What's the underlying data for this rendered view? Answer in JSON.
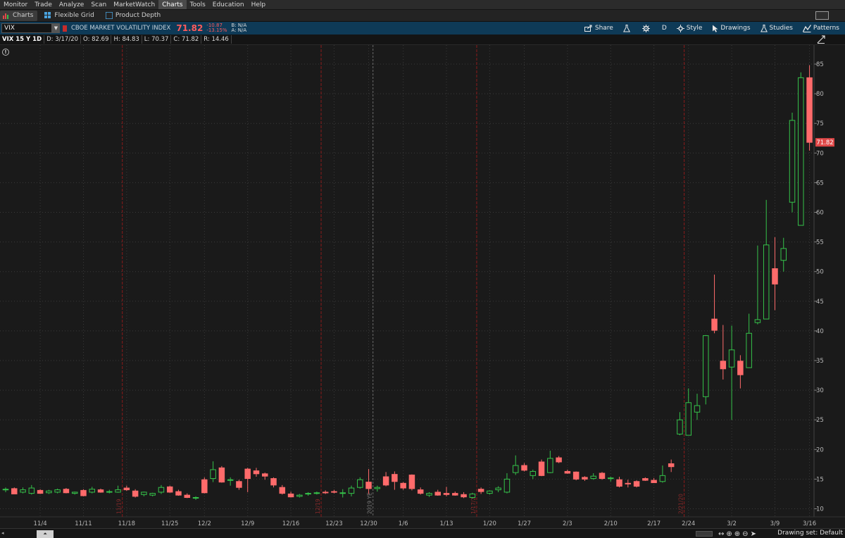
{
  "menu": {
    "items": [
      "Monitor",
      "Trade",
      "Analyze",
      "Scan",
      "MarketWatch",
      "Charts",
      "Tools",
      "Education",
      "Help"
    ],
    "active": "Charts"
  },
  "subtabs": [
    {
      "label": "Charts",
      "icon": "chart-icon",
      "active": true
    },
    {
      "label": "Flexible Grid",
      "icon": "grid-icon",
      "active": false
    },
    {
      "label": "Product Depth",
      "icon": "depth-icon",
      "active": false
    }
  ],
  "symbol": {
    "value": "VIX",
    "description": "CBOE MARKET VOLATILITY INDEX",
    "price": "71.82",
    "change": "-10.87",
    "change_pct": "-13.15%",
    "bid": "B: N/A",
    "ask": "A: N/A"
  },
  "toolbar": {
    "share": "Share",
    "aggregation": "D",
    "style": "Style",
    "drawings": "Drawings",
    "studies": "Studies",
    "patterns": "Patterns"
  },
  "info": {
    "title": "VIX 15 Y 1D",
    "date": "D: 3/17/20",
    "open": "O: 82.69",
    "high": "H: 84.83",
    "low": "L: 70.37",
    "close": "C: 71.82",
    "range": "R: 14.46"
  },
  "bottom": {
    "drawing_set": "Drawing set: Default"
  },
  "colors": {
    "up": "#35c24a",
    "down": "#ff6b6b",
    "background": "#1a1a1a",
    "grid": "#3a3a3a",
    "separator": "#8b1a1a",
    "year_separator": "#6a6a6a",
    "symbol_bar": "#0e3a57"
  },
  "chart_data": {
    "type": "candlestick",
    "ylim": [
      9,
      86
    ],
    "y_ticks": [
      10,
      15,
      20,
      25,
      30,
      35,
      40,
      45,
      50,
      55,
      60,
      65,
      70,
      75,
      80,
      85
    ],
    "x_tick_labels": [
      "11/4",
      "11/11",
      "11/18",
      "11/25",
      "12/2",
      "12/9",
      "12/16",
      "12/23",
      "12/30",
      "1/6",
      "1/13",
      "1/20",
      "1/27",
      "2/3",
      "2/10",
      "2/17",
      "2/24",
      "3/2",
      "3/9",
      "3/16"
    ],
    "x_tick_index": [
      4,
      9,
      14,
      19,
      23,
      28,
      33,
      38,
      42,
      46,
      51,
      56,
      60,
      65,
      70,
      75,
      79,
      84,
      89,
      93
    ],
    "month_separators": [
      {
        "index": 14,
        "label": "11/19",
        "kind": "month"
      },
      {
        "index": 37,
        "label": "12/19",
        "kind": "month"
      },
      {
        "index": 43,
        "label": "2019 YE",
        "kind": "year"
      },
      {
        "index": 55,
        "label": "1/17/20",
        "kind": "month"
      },
      {
        "index": 79,
        "label": "2/21/20",
        "kind": "month"
      }
    ],
    "current_price_label": "71.82",
    "candles": [
      {
        "o": 13.2,
        "h": 13.6,
        "l": 12.8,
        "c": 13.3
      },
      {
        "o": 13.4,
        "h": 13.6,
        "l": 12.5,
        "c": 12.5
      },
      {
        "o": 12.8,
        "h": 13.6,
        "l": 12.6,
        "c": 13.2
      },
      {
        "o": 12.6,
        "h": 14.0,
        "l": 12.4,
        "c": 13.5
      },
      {
        "o": 13.1,
        "h": 13.3,
        "l": 12.5,
        "c": 12.6
      },
      {
        "o": 12.7,
        "h": 13.2,
        "l": 12.5,
        "c": 13.0
      },
      {
        "o": 12.8,
        "h": 13.4,
        "l": 12.6,
        "c": 13.2
      },
      {
        "o": 13.3,
        "h": 13.5,
        "l": 12.6,
        "c": 12.7
      },
      {
        "o": 12.6,
        "h": 12.9,
        "l": 12.4,
        "c": 12.8
      },
      {
        "o": 13.1,
        "h": 13.3,
        "l": 12.1,
        "c": 12.2
      },
      {
        "o": 12.8,
        "h": 13.7,
        "l": 12.6,
        "c": 13.3
      },
      {
        "o": 13.2,
        "h": 13.4,
        "l": 12.7,
        "c": 12.8
      },
      {
        "o": 12.9,
        "h": 13.2,
        "l": 12.6,
        "c": 12.9
      },
      {
        "o": 12.8,
        "h": 13.9,
        "l": 12.7,
        "c": 13.2
      },
      {
        "o": 13.5,
        "h": 13.9,
        "l": 13.0,
        "c": 13.2
      },
      {
        "o": 13.0,
        "h": 13.3,
        "l": 11.9,
        "c": 12.1
      },
      {
        "o": 12.4,
        "h": 12.9,
        "l": 12.1,
        "c": 12.8
      },
      {
        "o": 12.3,
        "h": 12.7,
        "l": 12.1,
        "c": 12.6
      },
      {
        "o": 12.8,
        "h": 14.0,
        "l": 12.5,
        "c": 13.6
      },
      {
        "o": 13.7,
        "h": 13.9,
        "l": 12.7,
        "c": 12.8
      },
      {
        "o": 12.9,
        "h": 13.2,
        "l": 12.2,
        "c": 12.3
      },
      {
        "o": 12.3,
        "h": 12.6,
        "l": 11.8,
        "c": 11.9
      },
      {
        "o": 11.8,
        "h": 12.1,
        "l": 11.5,
        "c": 11.9
      },
      {
        "o": 14.9,
        "h": 15.3,
        "l": 12.6,
        "c": 12.7
      },
      {
        "o": 15.1,
        "h": 18.0,
        "l": 14.5,
        "c": 16.6
      },
      {
        "o": 16.9,
        "h": 17.2,
        "l": 14.4,
        "c": 14.5
      },
      {
        "o": 14.9,
        "h": 15.3,
        "l": 13.9,
        "c": 14.9
      },
      {
        "o": 14.6,
        "h": 14.9,
        "l": 13.2,
        "c": 13.6
      },
      {
        "o": 16.7,
        "h": 16.9,
        "l": 12.8,
        "c": 15.1
      },
      {
        "o": 16.4,
        "h": 16.9,
        "l": 15.4,
        "c": 15.9
      },
      {
        "o": 15.9,
        "h": 16.1,
        "l": 14.9,
        "c": 15.5
      },
      {
        "o": 15.1,
        "h": 15.3,
        "l": 13.6,
        "c": 14.0
      },
      {
        "o": 13.6,
        "h": 14.0,
        "l": 12.4,
        "c": 12.6
      },
      {
        "o": 12.5,
        "h": 12.9,
        "l": 11.9,
        "c": 12.0
      },
      {
        "o": 12.1,
        "h": 12.5,
        "l": 11.9,
        "c": 12.3
      },
      {
        "o": 12.5,
        "h": 12.8,
        "l": 12.2,
        "c": 12.6
      },
      {
        "o": 12.6,
        "h": 12.9,
        "l": 12.4,
        "c": 12.7
      },
      {
        "o": 12.8,
        "h": 13.1,
        "l": 12.5,
        "c": 12.7
      },
      {
        "o": 12.9,
        "h": 13.2,
        "l": 12.6,
        "c": 12.8
      },
      {
        "o": 12.6,
        "h": 13.3,
        "l": 11.9,
        "c": 12.7
      },
      {
        "o": 12.6,
        "h": 13.9,
        "l": 12.1,
        "c": 13.5
      },
      {
        "o": 13.6,
        "h": 15.3,
        "l": 13.4,
        "c": 14.9
      },
      {
        "o": 14.5,
        "h": 16.7,
        "l": 12.5,
        "c": 13.4
      },
      {
        "o": 13.4,
        "h": 13.9,
        "l": 12.9,
        "c": 13.6
      },
      {
        "o": 15.4,
        "h": 16.2,
        "l": 13.8,
        "c": 14.0
      },
      {
        "o": 15.8,
        "h": 16.3,
        "l": 13.2,
        "c": 14.6
      },
      {
        "o": 14.3,
        "h": 14.5,
        "l": 13.2,
        "c": 13.5
      },
      {
        "o": 15.7,
        "h": 15.8,
        "l": 13.1,
        "c": 13.4
      },
      {
        "o": 13.2,
        "h": 13.6,
        "l": 12.4,
        "c": 12.6
      },
      {
        "o": 12.3,
        "h": 12.8,
        "l": 12.0,
        "c": 12.6
      },
      {
        "o": 12.8,
        "h": 13.2,
        "l": 12.2,
        "c": 12.3
      },
      {
        "o": 12.6,
        "h": 13.7,
        "l": 12.1,
        "c": 12.4
      },
      {
        "o": 12.6,
        "h": 12.9,
        "l": 12.2,
        "c": 12.3
      },
      {
        "o": 12.4,
        "h": 12.8,
        "l": 11.8,
        "c": 12.0
      },
      {
        "o": 11.9,
        "h": 12.7,
        "l": 11.7,
        "c": 12.5
      },
      {
        "o": 13.3,
        "h": 13.6,
        "l": 12.5,
        "c": 12.9
      },
      {
        "o": 12.6,
        "h": 13.1,
        "l": 12.4,
        "c": 13.0
      },
      {
        "o": 13.2,
        "h": 13.8,
        "l": 12.8,
        "c": 13.5
      },
      {
        "o": 12.8,
        "h": 16.0,
        "l": 12.6,
        "c": 15.0
      },
      {
        "o": 16.1,
        "h": 19.0,
        "l": 15.7,
        "c": 17.3
      },
      {
        "o": 17.3,
        "h": 17.7,
        "l": 16.3,
        "c": 16.5
      },
      {
        "o": 15.6,
        "h": 16.6,
        "l": 15.0,
        "c": 16.3
      },
      {
        "o": 17.9,
        "h": 18.3,
        "l": 15.5,
        "c": 15.6
      },
      {
        "o": 16.1,
        "h": 19.8,
        "l": 16.0,
        "c": 18.5
      },
      {
        "o": 18.6,
        "h": 18.9,
        "l": 17.7,
        "c": 17.9
      },
      {
        "o": 16.3,
        "h": 16.6,
        "l": 15.9,
        "c": 16.0
      },
      {
        "o": 16.2,
        "h": 16.3,
        "l": 14.8,
        "c": 15.0
      },
      {
        "o": 15.3,
        "h": 15.5,
        "l": 14.7,
        "c": 15.0
      },
      {
        "o": 15.1,
        "h": 16.0,
        "l": 14.9,
        "c": 15.5
      },
      {
        "o": 16.0,
        "h": 16.2,
        "l": 14.9,
        "c": 15.1
      },
      {
        "o": 15.2,
        "h": 15.4,
        "l": 14.6,
        "c": 15.2
      },
      {
        "o": 14.9,
        "h": 15.4,
        "l": 13.6,
        "c": 13.8
      },
      {
        "o": 14.3,
        "h": 14.9,
        "l": 13.6,
        "c": 14.2
      },
      {
        "o": 14.6,
        "h": 14.8,
        "l": 13.6,
        "c": 13.8
      },
      {
        "o": 15.1,
        "h": 15.3,
        "l": 14.7,
        "c": 14.8
      },
      {
        "o": 14.8,
        "h": 15.2,
        "l": 14.4,
        "c": 14.4
      },
      {
        "o": 14.6,
        "h": 17.3,
        "l": 14.4,
        "c": 15.6
      },
      {
        "o": 17.6,
        "h": 18.3,
        "l": 16.2,
        "c": 17.1
      },
      {
        "o": 22.6,
        "h": 26.3,
        "l": 22.4,
        "c": 25.0
      },
      {
        "o": 22.4,
        "h": 30.3,
        "l": 22.4,
        "c": 27.9
      },
      {
        "o": 26.3,
        "h": 29.4,
        "l": 25.0,
        "c": 27.4
      },
      {
        "o": 28.9,
        "h": 39.3,
        "l": 27.6,
        "c": 39.2
      },
      {
        "o": 42.0,
        "h": 49.5,
        "l": 39.6,
        "c": 40.1
      },
      {
        "o": 34.9,
        "h": 41.0,
        "l": 31.8,
        "c": 33.6
      },
      {
        "o": 33.9,
        "h": 40.9,
        "l": 25.0,
        "c": 36.8
      },
      {
        "o": 34.9,
        "h": 35.9,
        "l": 30.3,
        "c": 32.6
      },
      {
        "o": 33.8,
        "h": 42.9,
        "l": 33.8,
        "c": 39.6
      },
      {
        "o": 41.4,
        "h": 54.4,
        "l": 41.1,
        "c": 41.9
      },
      {
        "o": 42.0,
        "h": 62.1,
        "l": 42.0,
        "c": 54.5
      },
      {
        "o": 50.5,
        "h": 55.8,
        "l": 43.5,
        "c": 47.9
      },
      {
        "o": 51.9,
        "h": 55.7,
        "l": 50.0,
        "c": 53.9
      },
      {
        "o": 61.7,
        "h": 76.8,
        "l": 60.0,
        "c": 75.5
      },
      {
        "o": 57.8,
        "h": 83.6,
        "l": 57.8,
        "c": 82.7
      },
      {
        "o": 82.7,
        "h": 84.8,
        "l": 70.4,
        "c": 71.8
      }
    ]
  }
}
